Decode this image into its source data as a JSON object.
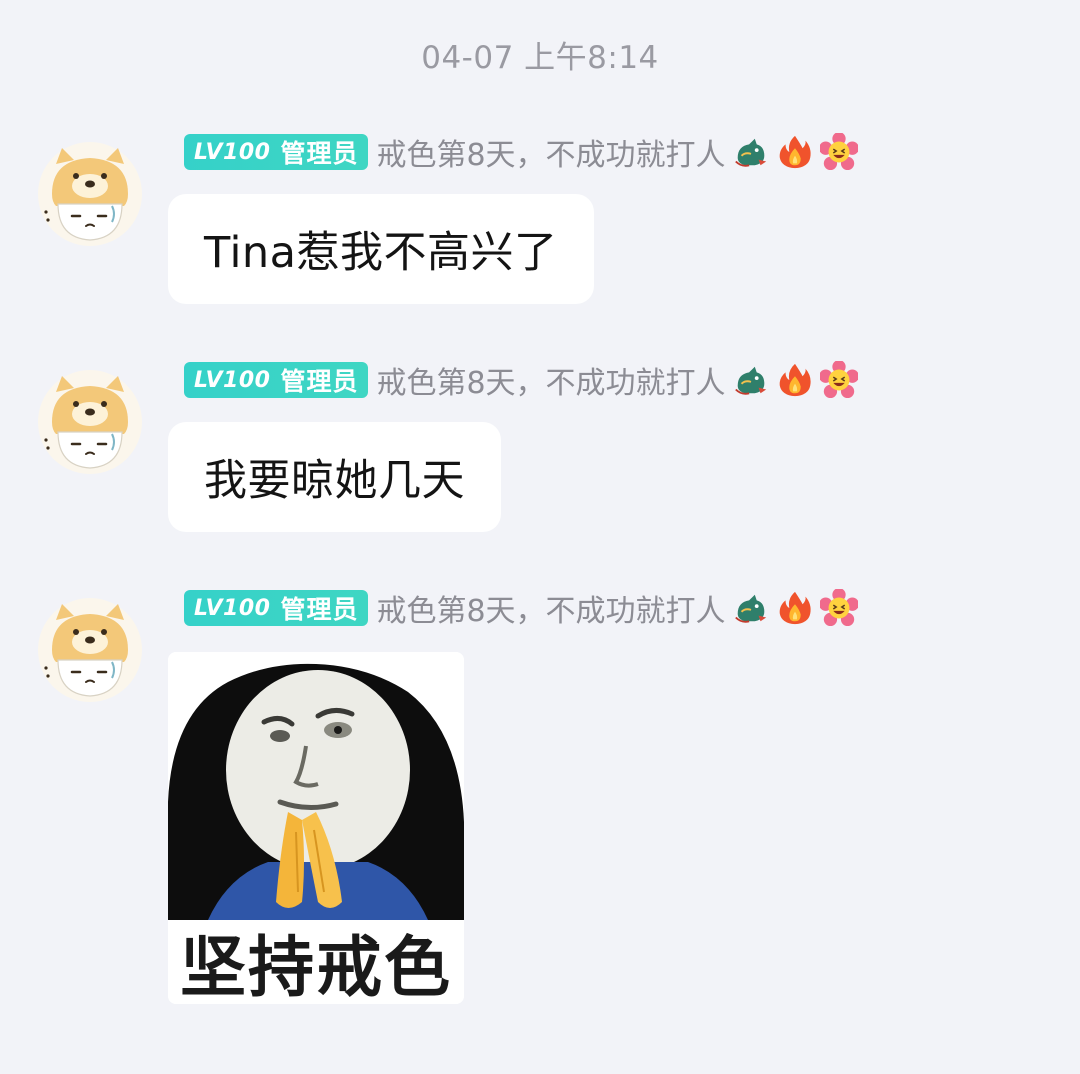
{
  "timestamp": "04-07 上午8:14",
  "messages": [
    {
      "level": "LV100",
      "role": "管理员",
      "name": "戒色第8天，不成功就打人",
      "emojis": [
        "dragon-icon",
        "fire-icon",
        "laughing-flower-icon"
      ],
      "text": "Tina惹我不高兴了"
    },
    {
      "level": "LV100",
      "role": "管理员",
      "name": "戒色第8天，不成功就打人",
      "emojis": [
        "dragon-icon",
        "fire-icon",
        "laughing-flower-icon"
      ],
      "text": "我要晾她几天"
    },
    {
      "level": "LV100",
      "role": "管理员",
      "name": "戒色第8天，不成功就打人",
      "emojis": [
        "dragon-icon",
        "fire-icon",
        "laughing-flower-icon"
      ],
      "sticker_caption": "坚持戒色"
    }
  ],
  "colors": {
    "background": "#f2f3f8",
    "badge": "#3fd6c3",
    "bubble": "#ffffff",
    "timestamp": "#9a9aa2"
  }
}
